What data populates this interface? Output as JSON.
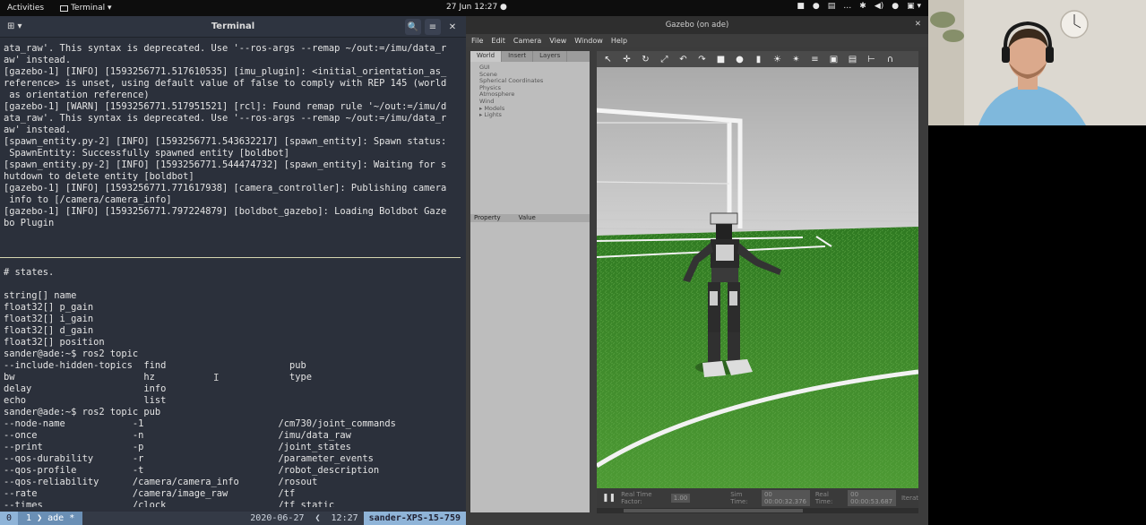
{
  "topbar": {
    "activities": "Activities",
    "app_menu": "Terminal ▾",
    "clock": "27 Jun 12:27 ●",
    "tray": [
      "■",
      "●",
      "▤",
      "…",
      "✱",
      "◀)",
      "●",
      "▣ ▾"
    ]
  },
  "terminal": {
    "title": "Terminal",
    "tab_button": "⊞ ▾",
    "search_icon": "🔍",
    "menu_icon": "≡",
    "close_icon": "✕",
    "top_lines": [
      "ata_raw'. This syntax is deprecated. Use '--ros-args --remap ~/out:=/imu/data_r",
      "aw' instead.",
      "[gazebo-1] [INFO] [1593256771.517610535] [imu_plugin]: <initial_orientation_as_",
      "reference> is unset, using default value of false to comply with REP 145 (world",
      " as orientation reference)",
      "[gazebo-1] [WARN] [1593256771.517951521] [rcl]: Found remap rule '~/out:=/imu/d",
      "ata_raw'. This syntax is deprecated. Use '--ros-args --remap ~/out:=/imu/data_r",
      "aw' instead.",
      "[spawn_entity.py-2] [INFO] [1593256771.543632217] [spawn_entity]: Spawn status:",
      " SpawnEntity: Successfully spawned entity [boldbot]",
      "[spawn_entity.py-2] [INFO] [1593256771.544474732] [spawn_entity]: Waiting for s",
      "hutdown to delete entity [boldbot]",
      "[gazebo-1] [INFO] [1593256771.771617938] [camera_controller]: Publishing camera",
      " info to [/camera/camera_info]",
      "[gazebo-1] [INFO] [1593256771.797224879] [boldbot_gazebo]: Loading Boldbot Gaze",
      "bo Plugin"
    ],
    "bottom_lines": [
      "# states.",
      "",
      "string[] name",
      "float32[] p_gain",
      "float32[] i_gain",
      "float32[] d_gain",
      "float32[] position",
      "sander@ade:~$ ros2 topic",
      "--include-hidden-topics  find                      pub",
      "bw                       hz                        type",
      "delay                    info",
      "echo                     list",
      "sander@ade:~$ ros2 topic pub",
      "--node-name            -1                        /cm730/joint_commands",
      "--once                 -n                        /imu/data_raw",
      "--print                -p                        /joint_states",
      "--qos-durability       -r                        /parameter_events",
      "--qos-profile          -t                        /robot_description",
      "--qos-reliability      /camera/camera_info       /rosout",
      "--rate                 /camera/image_raw         /tf",
      "--times                /clock                    /tf_static"
    ],
    "prompt_line": "sander@ade:~$ ros2 topic pub ",
    "ibeam": "I",
    "status": {
      "session": "0",
      "window": "1 ❯ ade *",
      "date": "2020-06-27",
      "time": "12:27",
      "host": "sander-XPS-15-759"
    }
  },
  "gazebo": {
    "title": "Gazebo (on ade)",
    "menu": [
      "File",
      "Edit",
      "Camera",
      "View",
      "Window",
      "Help"
    ],
    "tabs": [
      "World",
      "Insert",
      "Layers"
    ],
    "tree": [
      "GUI",
      "Scene",
      "Spherical Coordinates",
      "Physics",
      "Atmosphere",
      "Wind",
      "▸ Models",
      "▸ Lights"
    ],
    "props": [
      "Property",
      "Value"
    ],
    "toolbar_icons": [
      "↖",
      "✛",
      "↻",
      "⤢",
      "↶",
      "↷",
      "■",
      "●",
      "▮",
      "☀",
      "✴",
      "≡",
      "▣",
      "▤",
      "⊢",
      "∩"
    ],
    "bottom": {
      "rtf_label": "Real Time Factor:",
      "rtf_value": "1.00",
      "sim_label": "Sim Time:",
      "sim_value": "00 00:00:32.376",
      "real_label": "Real Time:",
      "real_value": "00 00:00:53.687",
      "iter_label": "Iterat"
    }
  },
  "colors": {
    "terminal_bg": "#2b303b",
    "status_accent": "#8fb4d8",
    "grass": "#3f8a2b"
  }
}
